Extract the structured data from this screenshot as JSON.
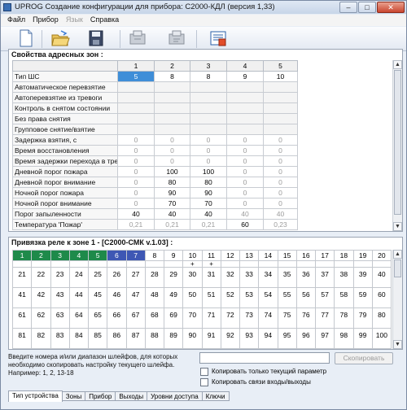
{
  "window": {
    "title": "UPROG  Создание конфигурации для прибора: С2000-КДЛ (версия  1,33)",
    "minimize": "–",
    "maximize": "□",
    "close": "✕"
  },
  "menu": [
    "Файл",
    "Прибор",
    "Язык",
    "Справка"
  ],
  "toolbar": [
    "new-icon",
    "open-icon",
    "save-icon",
    "read-device-icon",
    "write-device-icon",
    "device-config-icon"
  ],
  "zones": {
    "title": "Свойства адресных зон :",
    "columns": [
      "1",
      "2",
      "3",
      "4",
      "5"
    ],
    "rows": [
      {
        "label": "Тип ШС",
        "values": [
          "5",
          "8",
          "8",
          "9",
          "10"
        ]
      },
      {
        "label": "Автоматическое перевзятие",
        "values": [
          "",
          "",
          "",
          "",
          ""
        ]
      },
      {
        "label": "Автоперевзятие из тревоги",
        "values": [
          "",
          "",
          "",
          "",
          ""
        ]
      },
      {
        "label": "Контроль в снятом состоянии",
        "values": [
          "",
          "",
          "",
          "",
          ""
        ]
      },
      {
        "label": "Без права снятия",
        "values": [
          "",
          "",
          "",
          "",
          ""
        ]
      },
      {
        "label": "Групповое снятие/взятие",
        "values": [
          "",
          "",
          "",
          "",
          ""
        ]
      },
      {
        "label": "Задержка взятия, с",
        "values": [
          "0",
          "0",
          "0",
          "0",
          "0"
        ]
      },
      {
        "label": "Время восстановления",
        "values": [
          "0",
          "0",
          "0",
          "0",
          "0"
        ]
      },
      {
        "label": "Время задержки перехода в тревогу",
        "values": [
          "0",
          "0",
          "0",
          "0",
          "0"
        ]
      },
      {
        "label": "Дневной порог пожара",
        "values": [
          "0",
          "100",
          "100",
          "0",
          "0"
        ]
      },
      {
        "label": "Дневной порог внимание",
        "values": [
          "0",
          "80",
          "80",
          "0",
          "0"
        ]
      },
      {
        "label": "Ночной порог пожара",
        "values": [
          "0",
          "90",
          "90",
          "0",
          "0"
        ]
      },
      {
        "label": "Ночной порог внимание",
        "values": [
          "0",
          "70",
          "70",
          "0",
          "0"
        ]
      },
      {
        "label": "Порог запыленности",
        "values": [
          "40",
          "40",
          "40",
          "40",
          "40"
        ]
      },
      {
        "label": "Температура 'Пожар'",
        "values": [
          "0,21",
          "0,21",
          "0,21",
          "60",
          "0,23"
        ]
      }
    ]
  },
  "relay": {
    "title": "Привязка реле к зоне 1 - [С2000-СМК v.1.03] :",
    "rows": [
      [
        "1",
        "2",
        "3",
        "4",
        "5",
        "6",
        "7",
        "8",
        "9",
        "10",
        "11",
        "12",
        "13",
        "14",
        "15",
        "16",
        "17",
        "18",
        "19",
        "20"
      ],
      [
        "21",
        "22",
        "23",
        "24",
        "25",
        "26",
        "27",
        "28",
        "29",
        "30",
        "31",
        "32",
        "33",
        "34",
        "35",
        "36",
        "37",
        "38",
        "39",
        "40"
      ],
      [
        "41",
        "42",
        "43",
        "44",
        "45",
        "46",
        "47",
        "48",
        "49",
        "50",
        "51",
        "52",
        "53",
        "54",
        "55",
        "56",
        "57",
        "58",
        "59",
        "60"
      ],
      [
        "61",
        "62",
        "63",
        "64",
        "65",
        "66",
        "67",
        "68",
        "69",
        "70",
        "71",
        "72",
        "73",
        "74",
        "75",
        "76",
        "77",
        "78",
        "79",
        "80"
      ],
      [
        "81",
        "82",
        "83",
        "84",
        "85",
        "86",
        "87",
        "88",
        "89",
        "90",
        "91",
        "92",
        "93",
        "94",
        "95",
        "96",
        "97",
        "98",
        "99",
        "100"
      ]
    ],
    "marks": "+"
  },
  "copy": {
    "hint": "Введите номера и/или диапазон шлейфов, для которых необходимо скопировать настройку текущего шлейфа. Например: 1, 2, 13-18",
    "button": "Скопировать",
    "chk_current": "Копировать только текущий параметр",
    "chk_links": "Копировать связи входы/выходы"
  },
  "tabs": [
    "Тип устройства",
    "Зоны",
    "Прибор",
    "Выходы",
    "Уровни доступа",
    "Ключи"
  ]
}
